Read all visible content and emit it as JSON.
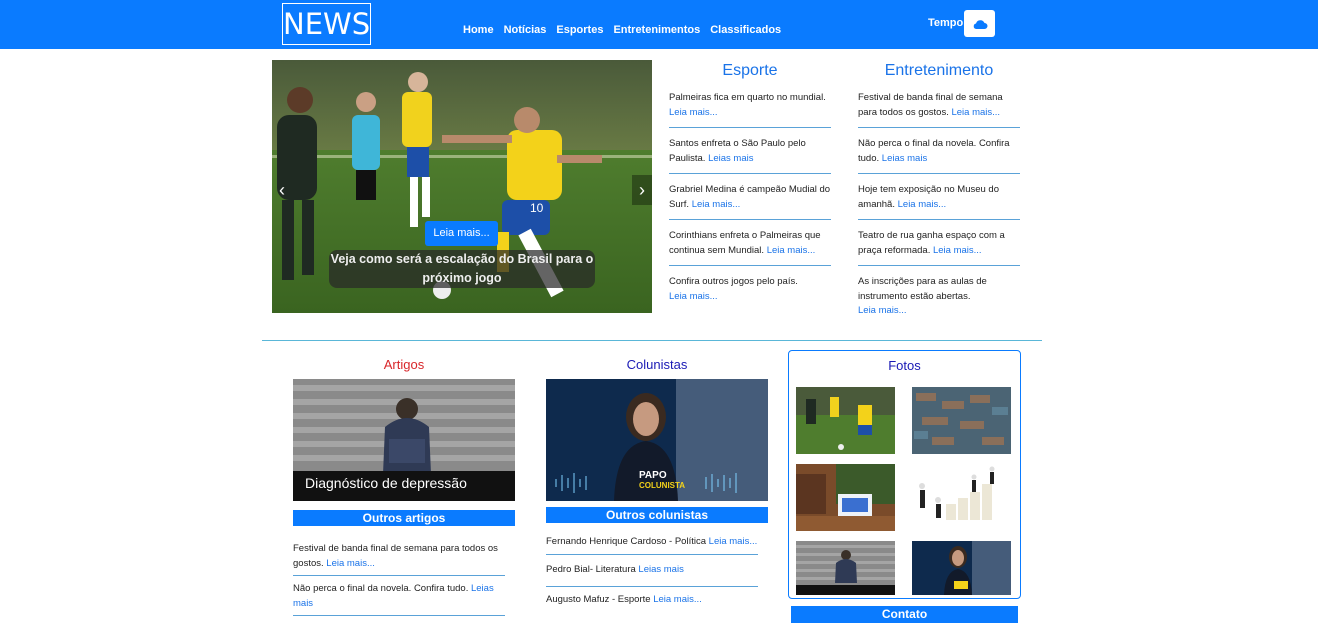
{
  "header": {
    "logo": "NEWS",
    "nav": [
      "Home",
      "Notícias",
      "Esportes",
      "Entretenimentos",
      "Classificados"
    ],
    "tempo_label": "Tempo",
    "weather_icon": "cloud-icon"
  },
  "carousel": {
    "button": "Leia mais...",
    "caption": "Veja como será a escalação do Brasil para o próximo jogo"
  },
  "esporte": {
    "title": "Esporte",
    "items": [
      {
        "text": "Palmeiras fica em quarto no mundial.",
        "link": "Leia mais..."
      },
      {
        "text": "Santos enfreta o São Paulo pelo Paulista.",
        "link": "Leias mais"
      },
      {
        "text": "Grabriel Medina é campeão Mudial do Surf.",
        "link": "Leia mais..."
      },
      {
        "text": "Corinthians enfreta o Palmeiras que continua sem Mundial.",
        "link": "Leia mais..."
      },
      {
        "text": "Confira outros jogos pelo país.",
        "link": "Leia mais..."
      }
    ]
  },
  "entretenimento": {
    "title": "Entretenimento",
    "items": [
      {
        "text": "Festival de banda final de semana para todos os gostos.",
        "link": "Leia mais..."
      },
      {
        "text": "Não perca o final da novela. Confira tudo.",
        "link": "Leias mais"
      },
      {
        "text": "Hoje tem exposição no Museu do amanhã.",
        "link": "Leia mais..."
      },
      {
        "text": "Teatro de rua ganha espaço com a praça reformada.",
        "link": "Leia mais..."
      },
      {
        "text": "As inscrições para as aulas de instrumento estão abertas.",
        "link": "Leia mais..."
      }
    ]
  },
  "artigos": {
    "title": "Artigos",
    "image_caption": "Diagnóstico de depressão",
    "bar": "Outros artigos",
    "items": [
      {
        "text": "Festival de banda final de semana para todos os gostos.",
        "link": "Leia mais..."
      },
      {
        "text": "Não perca o final da novela. Confira tudo.",
        "link": "Leias mais"
      }
    ]
  },
  "colunistas": {
    "title": "Colunistas",
    "image_text_1": "PAPO",
    "image_text_2": "COLUNISTA",
    "bar": "Outros colunistas",
    "items": [
      {
        "text": "Fernando Henrique Cardoso - Política",
        "link": "Leia mais..."
      },
      {
        "text": "Pedro Bial- Literatura",
        "link": "Leias mais"
      },
      {
        "text": "Augusto Mafuz - Esporte",
        "link": "Leia mais..."
      }
    ]
  },
  "fotos": {
    "title": "Fotos"
  },
  "contato": "Contato",
  "colors": {
    "primary": "#0a7bff",
    "link": "#1a73e8",
    "artigos_title": "#d8262a",
    "colunistas_title": "#1a1ab5"
  }
}
